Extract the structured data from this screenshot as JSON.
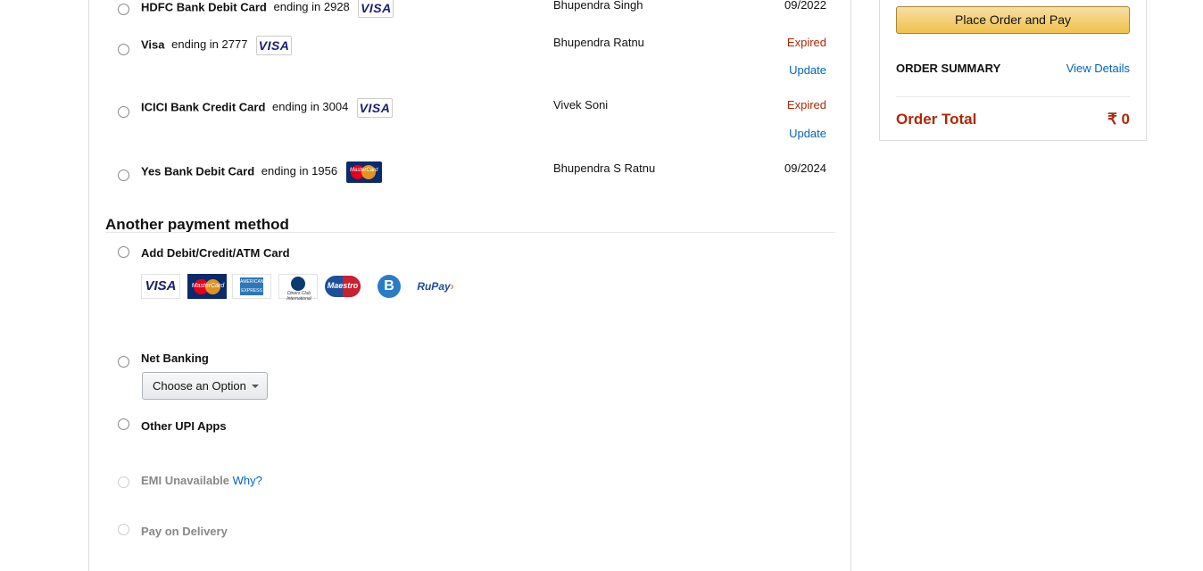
{
  "saved_cards": [
    {
      "bank": "HDFC Bank Debit Card",
      "ending": "ending in 2928",
      "network": "visa",
      "holder": "Bhupendra Singh",
      "status": "09/2022",
      "action": ""
    },
    {
      "bank": "Visa",
      "ending": "ending in 2777",
      "network": "visa",
      "holder": "Bhupendra Ratnu",
      "status": "Expired",
      "action": "Update"
    },
    {
      "bank": "ICICI Bank Credit Card",
      "ending": "ending in 3004",
      "network": "visa",
      "holder": "Vivek Soni",
      "status": "Expired",
      "action": "Update"
    },
    {
      "bank": "Yes Bank Debit Card",
      "ending": "ending in 1956",
      "network": "mastercard",
      "holder": "Bhupendra S Ratnu",
      "status": "09/2024",
      "action": ""
    }
  ],
  "logo_text": {
    "visa": "VISA",
    "mastercard": "MasterCard",
    "amex": "AMERICAN EXPRESS",
    "diners": "Diners Club International",
    "maestro": "Maestro",
    "bhim": "B",
    "rupay": "RuPay"
  },
  "another": {
    "title": "Another payment method",
    "add_card": "Add Debit/Credit/ATM Card",
    "net_banking": "Net Banking",
    "choose_option": "Choose an Option",
    "upi": "Other UPI Apps",
    "emi": "EMI Unavailable",
    "emi_why": "Why?",
    "pod": "Pay on Delivery"
  },
  "summary": {
    "place_order": "Place Order and Pay",
    "order_summary": "ORDER SUMMARY",
    "view_details": "View Details",
    "order_total_label": "Order Total",
    "order_total_value": "₹ 0"
  }
}
